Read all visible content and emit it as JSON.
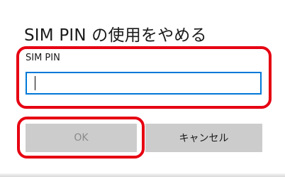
{
  "dialog": {
    "title": "SIM PIN の使用をやめる",
    "field_label": "SIM PIN",
    "input_value": "",
    "input_placeholder": "",
    "ok_label": "OK",
    "cancel_label": "キャンセル"
  },
  "colors": {
    "focus_border": "#0078d7",
    "highlight_annotation": "#e60012",
    "button_bg": "#cccccc",
    "ok_disabled_text": "#8a8a8a"
  }
}
